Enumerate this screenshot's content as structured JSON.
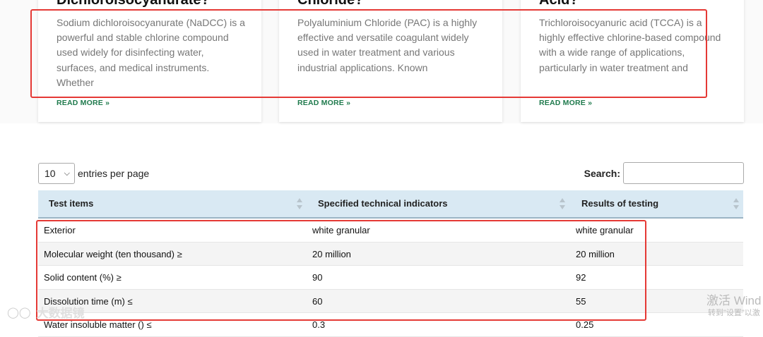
{
  "cards": [
    {
      "title": "Dichloroisocyanurate?",
      "excerpt": "Sodium dichloroisocyanurate (NaDCC) is a powerful and stable chlorine compound used widely for disinfecting water, surfaces, and medical instruments. Whether",
      "read_more": "READ MORE »"
    },
    {
      "title": "Chloride?",
      "excerpt": "Polyaluminium Chloride (PAC) is a highly effective and versatile coagulant widely used in water treatment and various industrial applications. Known",
      "read_more": "READ MORE »"
    },
    {
      "title": "Acid?",
      "excerpt": "Trichloroisocyanuric acid (TCCA) is a highly effective chlorine-based compound with a wide range of applications, particularly in water treatment and",
      "read_more": "READ MORE »"
    }
  ],
  "table_controls": {
    "entries_value": "10",
    "entries_label": "entries per page",
    "search_label": "Search:"
  },
  "table": {
    "headers": [
      "Test items",
      "Specified technical indicators",
      "Results of testing"
    ],
    "rows": [
      [
        "Exterior",
        "white granular",
        "white granular"
      ],
      [
        "Molecular weight (ten thousand) ≥",
        "20 million",
        "20 million"
      ],
      [
        "Solid content (%) ≥",
        "90",
        "92"
      ],
      [
        "Dissolution time (m) ≤",
        "60",
        "55"
      ],
      [
        "Water insoluble matter () ≤",
        "0.3",
        "0.25"
      ]
    ]
  },
  "overlays": {
    "activate_windows": "激活 Wind",
    "activate_windows_sub": "转到\"设置\"以激",
    "brand_text": "大数据镜"
  },
  "colors": {
    "annotation_red": "#e53935",
    "header_bg": "#d9e9f3",
    "read_more_green": "#1f7a4d"
  }
}
